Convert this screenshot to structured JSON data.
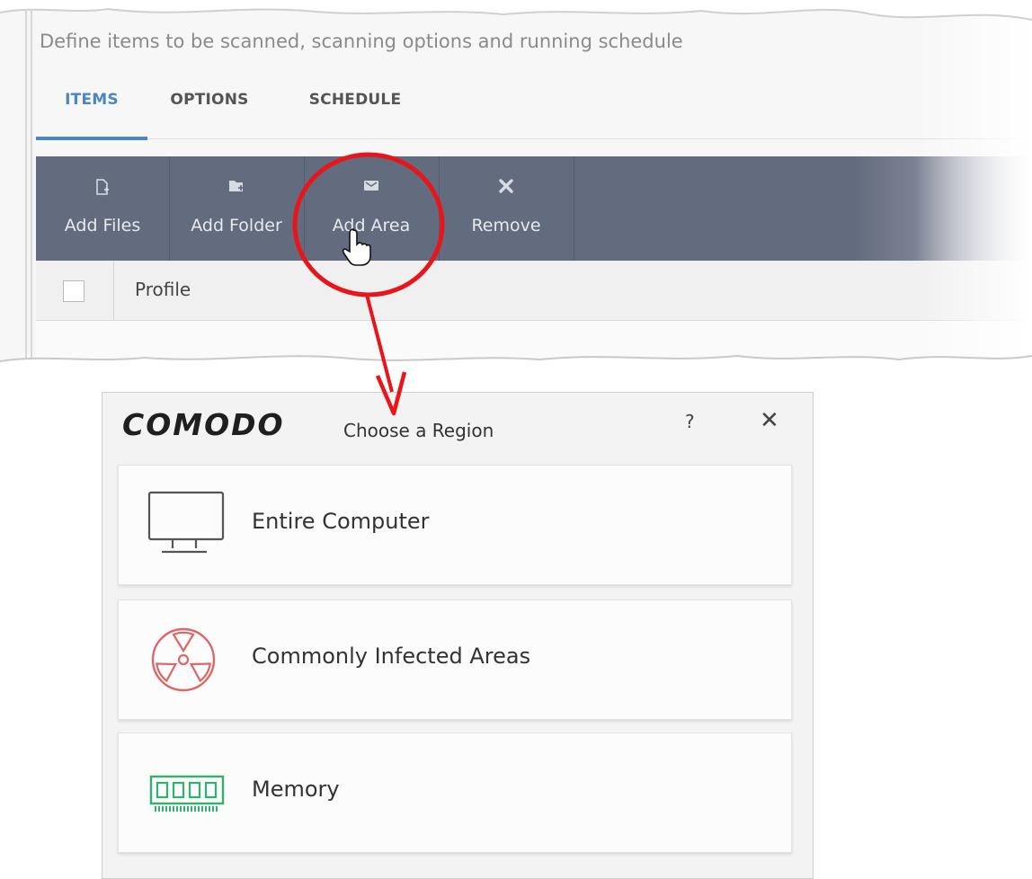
{
  "scan_settings": {
    "description": "Define items to be scanned, scanning options and running schedule",
    "tabs": [
      {
        "label": "ITEMS",
        "active": true
      },
      {
        "label": "OPTIONS",
        "active": false
      },
      {
        "label": "SCHEDULE",
        "active": false
      }
    ],
    "toolbar": {
      "add_files": {
        "label": "Add Files",
        "icon": "add-file-icon"
      },
      "add_folder": {
        "label": "Add Folder",
        "icon": "add-folder-icon"
      },
      "add_area": {
        "label": "Add Area",
        "icon": "area-icon"
      },
      "remove": {
        "label": "Remove",
        "icon": "close-icon"
      }
    },
    "grid": {
      "columns": [
        "Profile"
      ],
      "select_all_checked": false
    }
  },
  "dialog": {
    "brand": "COMODO",
    "title": "Choose a Region",
    "help_label": "?",
    "close_label": "✕",
    "options": [
      {
        "label": "Entire Computer",
        "icon": "monitor-icon"
      },
      {
        "label": "Commonly Infected Areas",
        "icon": "radiation-icon"
      },
      {
        "label": "Memory",
        "icon": "memory-chip-icon"
      }
    ]
  },
  "colors": {
    "accent": "#4a86c5",
    "toolbar": "#636b7e",
    "annotation": "#e8161b",
    "radiation": "#e06666",
    "memory": "#2fb36a"
  }
}
